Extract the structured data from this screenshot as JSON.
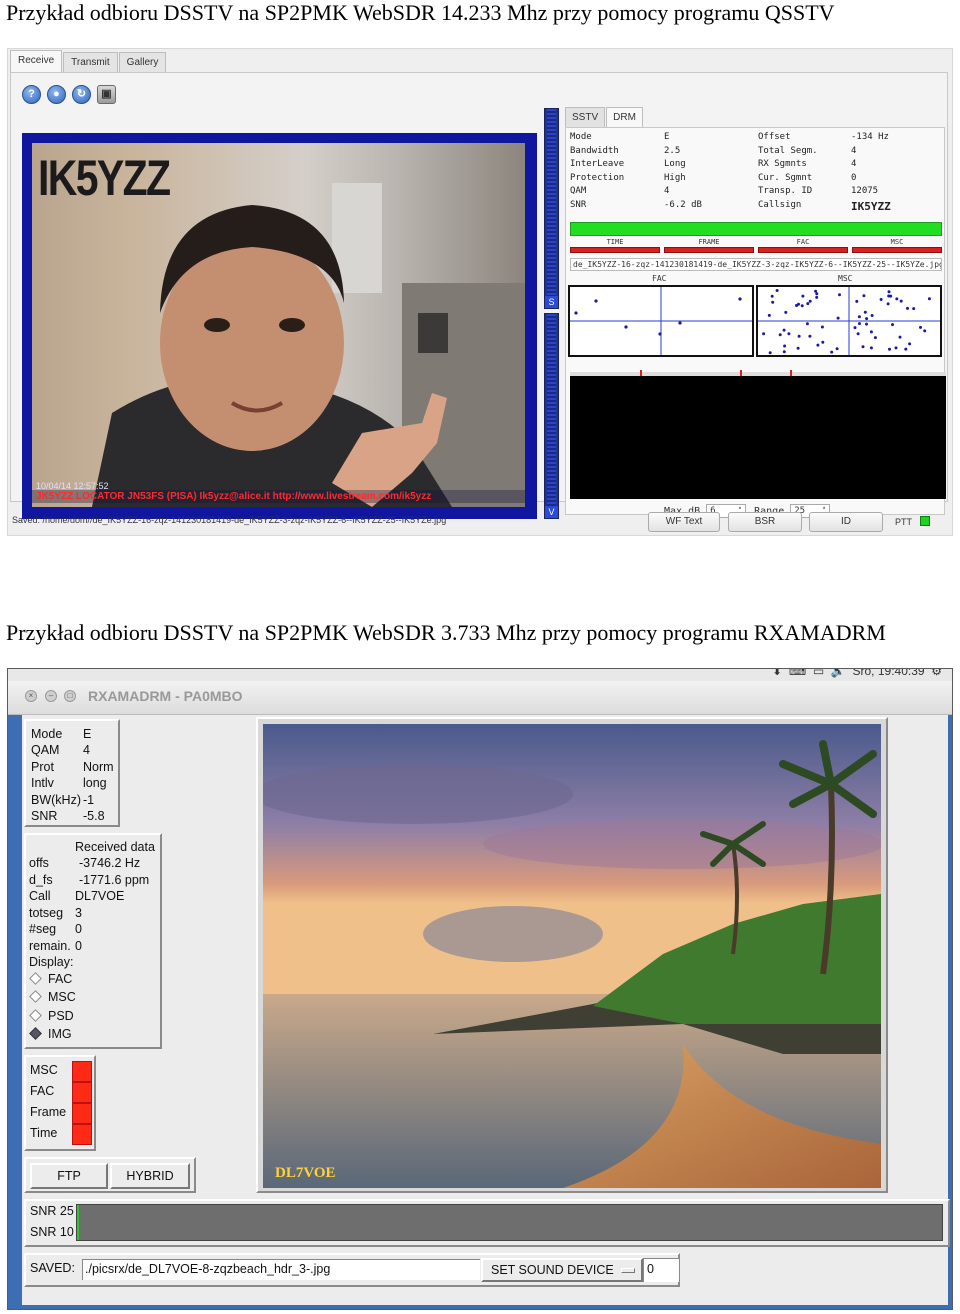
{
  "captions": {
    "top": "Przykład odbioru DSSTV na SP2PMK WebSDR 14.233 Mhz przy pomocy programu QSSTV",
    "bottom": "Przykład odbioru DSSTV na SP2PMK WebSDR 3.733 Mhz przy pomocy programu RXAMADRM"
  },
  "qsstv": {
    "tabs": [
      "Receive",
      "Transmit",
      "Gallery"
    ],
    "image": {
      "callsign": "IK5YZZ",
      "overlay_text": "JK5YZZ LOCATOR JN53FS (PISA) Ik5yzz@alice.it http://www.livestream.com/ik5yzz",
      "timestamp": "10/04/14 12:57:52"
    },
    "vbar_labels": [
      "S",
      "V"
    ],
    "right_tabs": [
      "SSTV",
      "DRM"
    ],
    "drm_info": [
      {
        "k1": "Mode",
        "v1": "E",
        "k2": "Offset",
        "v2": "-134 Hz"
      },
      {
        "k1": "Bandwidth",
        "v1": "2.5",
        "k2": "Total Segm.",
        "v2": "4"
      },
      {
        "k1": "InterLeave",
        "v1": "Long",
        "k2": "RX Sgmnts",
        "v2": "4"
      },
      {
        "k1": "Protection",
        "v1": "High",
        "k2": "Cur. Sgmnt",
        "v2": "0"
      },
      {
        "k1": "QAM",
        "v1": "4",
        "k2": "Transp. ID",
        "v2": "12075"
      },
      {
        "k1": "SNR",
        "v1": "-6.2 dB",
        "k2": "Callsign",
        "v2": "IK5YZZ"
      }
    ],
    "status_labels": [
      "TIME",
      "FRAME",
      "FAC",
      "MSC"
    ],
    "filename": "de_IK5YZZ-16-zqz-141230181419-de_IK5YZZ-3-zqz-IK5YZZ-6--IK5YZZ-25--IK5YZe.jpg",
    "plot_labels": {
      "fac": "FAC",
      "msc": "MSC"
    },
    "controls": {
      "maxdb_label": "Max dB",
      "maxdb_value": "6",
      "range_label": "Range",
      "range_value": "25"
    },
    "status_bar": "Saved: /home/dom//de_IK5YZZ-16-zqz-141230181419-de_IK5YZZ-3-zqz-IK5YZZ-6--IK5YZZ-25--IK5YZe.jpg",
    "buttons": {
      "wftext": "WF Text",
      "bsr": "BSR",
      "id": "ID"
    },
    "ptt_label": "PTT",
    "ptt_color": "#1fd21f"
  },
  "rxama": {
    "top_clock": "Sro, 19:40:39",
    "title": "RXAMADRM - PA0MBO",
    "mode_box": [
      {
        "k": "Mode",
        "v": "E"
      },
      {
        "k": "QAM",
        "v": "4"
      },
      {
        "k": "Prot",
        "v": "Norm"
      },
      {
        "k": "Intlv",
        "v": "long"
      },
      {
        "k": "BW(kHz)",
        "v": "-1"
      },
      {
        "k": "SNR",
        "v": "-5.8"
      }
    ],
    "received_header": "Received data",
    "received": [
      {
        "k": "offs",
        "v": "-3746.2 Hz"
      },
      {
        "k": "d_fs",
        "v": "-1771.6 ppm"
      },
      {
        "k": "Call",
        "v": "DL7VOE"
      },
      {
        "k": "totseg",
        "v": "3"
      },
      {
        "k": "#seg",
        "v": "0"
      },
      {
        "k": "remain.",
        "v": "0"
      }
    ],
    "display_label": "Display:",
    "display_options": [
      "FAC",
      "MSC",
      "PSD",
      "IMG"
    ],
    "display_selected": "IMG",
    "leds": [
      "MSC",
      "FAC",
      "Frame",
      "Time"
    ],
    "led_color": "#ff2a16",
    "buttons": {
      "ftp": "FTP",
      "hybrid": "HYBRID"
    },
    "snr_labels": [
      "SNR 25",
      "SNR 10"
    ],
    "saved_label": "SAVED:",
    "saved_value": "./picsrx/de_DL7VOE-8-zqzbeach_hdr_3-.jpg",
    "sound_device_button": "SET SOUND DEVICE",
    "sound_device_value": "0",
    "image_watermark": "DL7VOE"
  }
}
